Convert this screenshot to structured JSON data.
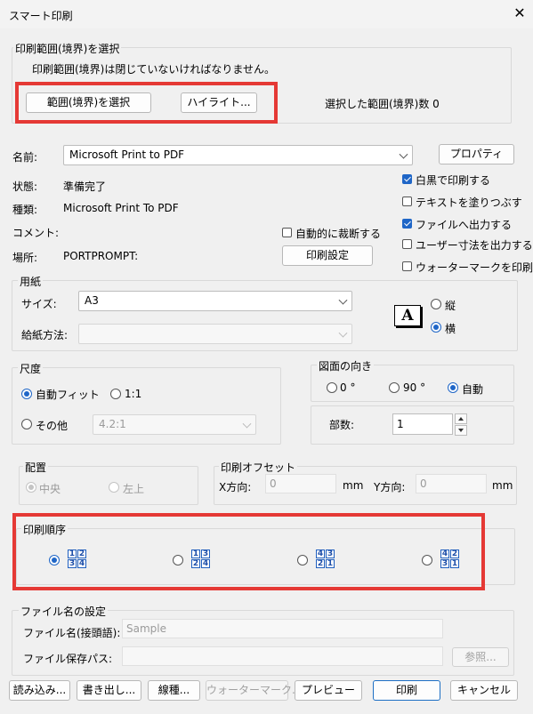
{
  "window": {
    "title": "スマート印刷",
    "close_glyph": "✕"
  },
  "range": {
    "group_title": "印刷範囲(境界)を選択",
    "notice": "印刷範囲(境界)は閉じていないければなりません。",
    "select_button": "範囲(境界)を選択",
    "highlight_button": "ハイライト...",
    "count_label": "選択した範囲(境界)数 0"
  },
  "printer": {
    "name_label": "名前:",
    "name_value": "Microsoft Print to PDF",
    "properties_button": "プロパティ",
    "status_label": "状態:",
    "status_value": "準備完了",
    "type_label": "種類:",
    "type_value": "Microsoft Print To PDF",
    "comment_label": "コメント:",
    "location_label": "場所:",
    "location_value": "PORTPROMPT:",
    "auto_cut_label": "自動的に裁断する",
    "print_settings_button": "印刷設定"
  },
  "options": {
    "monochrome": "白黒で印刷する",
    "fill_text": "テキストを塗りつぶす",
    "output_file": "ファイルへ出力する",
    "user_size": "ユーザー寸法を出力する",
    "watermark": "ウォーターマークを印刷する"
  },
  "paper": {
    "group_title": "用紙",
    "size_label": "サイズ:",
    "size_value": "A3",
    "feed_label": "給紙方法:",
    "feed_value": "",
    "preview_glyph": "A",
    "portrait": "縦",
    "landscape": "横"
  },
  "scale": {
    "group_title": "尺度",
    "auto_fit": "自動フィット",
    "one_to_one": "1:1",
    "other": "その他",
    "other_value": "4.2:1"
  },
  "orientation": {
    "group_title": "図面の向き",
    "deg0": "0 °",
    "deg90": "90 °",
    "auto": "自動"
  },
  "copies": {
    "label": "部数:",
    "value": "1"
  },
  "placement": {
    "group_title": "配置",
    "center": "中央",
    "top_left": "左上"
  },
  "offset": {
    "group_title": "印刷オフセット",
    "x_label": "X方向:",
    "x_value": "0",
    "y_label": "Y方向:",
    "y_value": "0",
    "x_unit": "mm",
    "y_unit": "mm"
  },
  "print_order": {
    "group_title": "印刷順序",
    "orders": [
      [
        "1",
        "2",
        "3",
        "4"
      ],
      [
        "1",
        "3",
        "2",
        "4"
      ],
      [
        "4",
        "3",
        "2",
        "1"
      ],
      [
        "4",
        "2",
        "3",
        "1"
      ]
    ]
  },
  "filename": {
    "group_title": "ファイル名の設定",
    "prefix_label": "ファイル名(接頭語):",
    "prefix_value": "Sample",
    "path_label": "ファイル保存パス:",
    "path_value": "",
    "browse_button": "参照..."
  },
  "footer": {
    "load": "読み込み...",
    "export": "書き出し...",
    "lineweight": "線種...",
    "watermark": "ウォーターマーク...",
    "preview": "プレビュー",
    "print": "印刷",
    "cancel": "キャンセル"
  },
  "colors": {
    "accent": "#1f66c7",
    "highlight_box": "#e53935"
  }
}
